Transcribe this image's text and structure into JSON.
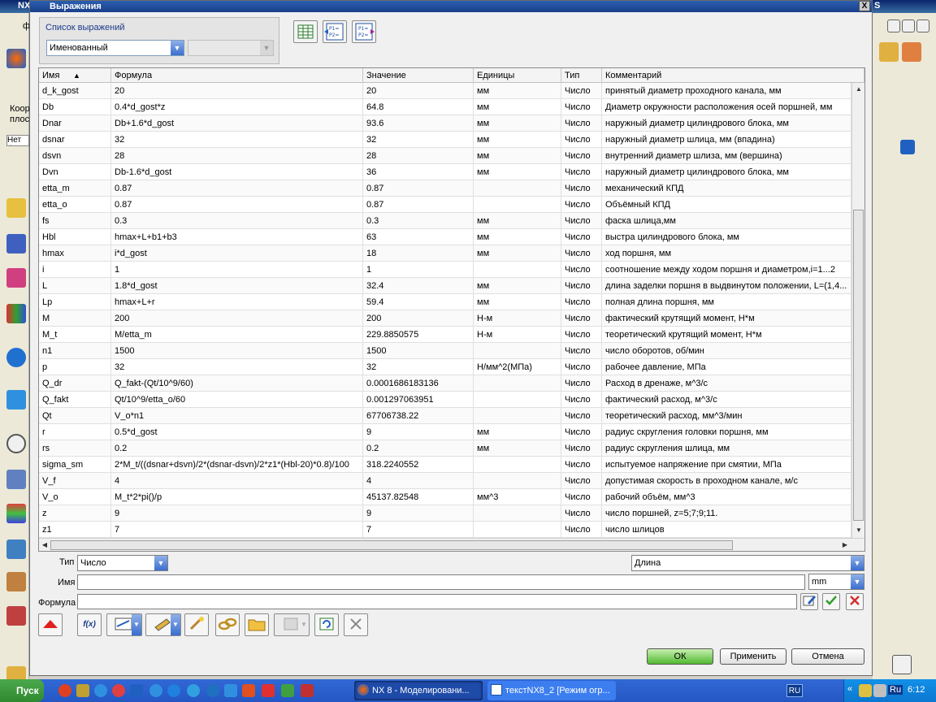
{
  "background_app": {
    "title_fragment": "NX",
    "title_right": "S",
    "menu_fragment": "ф",
    "left_labels": [
      "Коор",
      "плоск"
    ],
    "filter_fragment": "Нет ф"
  },
  "dialog": {
    "title": "Выражения",
    "close_label": "X",
    "list_group_label": "Список выражений",
    "list_type_value": "Именованный",
    "list_filter_value": "",
    "table": {
      "columns": [
        "Имя",
        "Формула",
        "Значение",
        "Единицы",
        "Тип",
        "Комментарий"
      ],
      "sorted_column": "Имя",
      "sort_direction": "ascending",
      "rows": [
        {
          "name": "d_k_gost",
          "formula": "20",
          "value": "20",
          "units": "мм",
          "type": "Число",
          "comment": "принятый диаметр проходного канала, мм"
        },
        {
          "name": "Db",
          "formula": "0.4*d_gost*z",
          "value": "64.8",
          "units": "мм",
          "type": "Число",
          "comment": "Диаметр окружности расположения осей поршней, мм"
        },
        {
          "name": "Dnar",
          "formula": "Db+1.6*d_gost",
          "value": "93.6",
          "units": "мм",
          "type": "Число",
          "comment": "наружный диаметр цилиндрового блока, мм"
        },
        {
          "name": "dsnar",
          "formula": "32",
          "value": "32",
          "units": "мм",
          "type": "Число",
          "comment": "наружный диаметр шлица, мм (впадина)"
        },
        {
          "name": "dsvn",
          "formula": "28",
          "value": "28",
          "units": "мм",
          "type": "Число",
          "comment": "внутренний диаметр шлиза, мм (вершина)"
        },
        {
          "name": "Dvn",
          "formula": "Db-1.6*d_gost",
          "value": "36",
          "units": "мм",
          "type": "Число",
          "comment": "наружный диаметр цилиндрового блока, мм"
        },
        {
          "name": "etta_m",
          "formula": "0.87",
          "value": "0.87",
          "units": "",
          "type": "Число",
          "comment": "механический КПД"
        },
        {
          "name": "etta_o",
          "formula": "0.87",
          "value": "0.87",
          "units": "",
          "type": "Число",
          "comment": "Объёмный КПД"
        },
        {
          "name": "fs",
          "formula": "0.3",
          "value": "0.3",
          "units": "мм",
          "type": "Число",
          "comment": "фаска шлица,мм"
        },
        {
          "name": "Hbl",
          "formula": "hmax+L+b1+b3",
          "value": "63",
          "units": "мм",
          "type": "Число",
          "comment": "выстра цилиндрового блока, мм"
        },
        {
          "name": "hmax",
          "formula": "i*d_gost",
          "value": "18",
          "units": "мм",
          "type": "Число",
          "comment": "ход поршня, мм"
        },
        {
          "name": "i",
          "formula": "1",
          "value": "1",
          "units": "",
          "type": "Число",
          "comment": "соотношение между  ходом поршня и диаметром,i=1...2"
        },
        {
          "name": "L",
          "formula": "1.8*d_gost",
          "value": "32.4",
          "units": "мм",
          "type": "Число",
          "comment": "длина заделки поршня в выдвинутом положении, L=(1,4..."
        },
        {
          "name": "Lp",
          "formula": "hmax+L+r",
          "value": "59.4",
          "units": "мм",
          "type": "Число",
          "comment": "полная длина поршня, мм"
        },
        {
          "name": "M",
          "formula": "200",
          "value": "200",
          "units": "Н-м",
          "type": "Число",
          "comment": "фактический крутящий момент, Н*м"
        },
        {
          "name": "M_t",
          "formula": "M/etta_m",
          "value": "229.8850575",
          "units": "Н-м",
          "type": "Число",
          "comment": "теоретический крутящий момент, Н*м"
        },
        {
          "name": "n1",
          "formula": "1500",
          "value": "1500",
          "units": "",
          "type": "Число",
          "comment": "число оборотов, об/мин"
        },
        {
          "name": "p",
          "formula": "32",
          "value": "32",
          "units": "Н/мм^2(МПа)",
          "type": "Число",
          "comment": "рабочее давление, МПа"
        },
        {
          "name": "Q_dr",
          "formula": "Q_fakt-(Qt/10^9/60)",
          "value": "0.0001686183136",
          "units": "",
          "type": "Число",
          "comment": "Расход в дренаже, м^3/с"
        },
        {
          "name": "Q_fakt",
          "formula": "Qt/10^9/etta_o/60",
          "value": "0.001297063951",
          "units": "",
          "type": "Число",
          "comment": "фактический расход, м^3/с"
        },
        {
          "name": "Qt",
          "formula": "V_o*n1",
          "value": "67706738.22",
          "units": "",
          "type": "Число",
          "comment": "теоретический расход, мм^3/мин"
        },
        {
          "name": "r",
          "formula": "0.5*d_gost",
          "value": "9",
          "units": "мм",
          "type": "Число",
          "comment": "радиус скругления головки поршня, мм"
        },
        {
          "name": "rs",
          "formula": "0.2",
          "value": "0.2",
          "units": "мм",
          "type": "Число",
          "comment": "радиус скругления шлица, мм"
        },
        {
          "name": "sigma_sm",
          "formula": "2*M_t/((dsnar+dsvn)/2*(dsnar-dsvn)/2*z1*(Hbl-20)*0.8)/100",
          "value": "318.2240552",
          "units": "",
          "type": "Число",
          "comment": "испытуемое напряжение при смятии, МПа"
        },
        {
          "name": "V_f",
          "formula": "4",
          "value": "4",
          "units": "",
          "type": "Число",
          "comment": "допустимая скорость в проходном канале, м/с"
        },
        {
          "name": "V_o",
          "formula": "M_t*2*pi()/p",
          "value": "45137.82548",
          "units": "мм^3",
          "type": "Число",
          "comment": "рабочий объём, мм^3"
        },
        {
          "name": "z",
          "formula": "9",
          "value": "9",
          "units": "",
          "type": "Число",
          "comment": "число поршней, z=5;7;9;11."
        },
        {
          "name": "z1",
          "formula": "7",
          "value": "7",
          "units": "",
          "type": "Число",
          "comment": "число шлицов"
        }
      ]
    },
    "form": {
      "type_label": "Тип",
      "type_value": "Число",
      "dimension_value": "Длина",
      "name_label": "Имя",
      "name_value": "",
      "units_value": "mm",
      "formula_label": "Формула",
      "formula_value": ""
    },
    "tool_buttons": {
      "fx": "f(x)",
      "p1p2": "P1\nP2="
    },
    "buttons": {
      "ok": "ОК",
      "apply": "Применить",
      "cancel": "Отмена"
    },
    "colors": {
      "accent": "#2a5fb0",
      "ok": "#50b830",
      "header_label": "#1a3a8a"
    }
  },
  "taskbar": {
    "start_label": "Пуск",
    "apps": [
      {
        "label": "NX 8 - Моделировани...",
        "active": true
      },
      {
        "label": "текстNX8_2 [Режим огр...",
        "active": false
      }
    ],
    "lang": "RU",
    "tray_lang": "Ru",
    "clock": "6:12"
  }
}
